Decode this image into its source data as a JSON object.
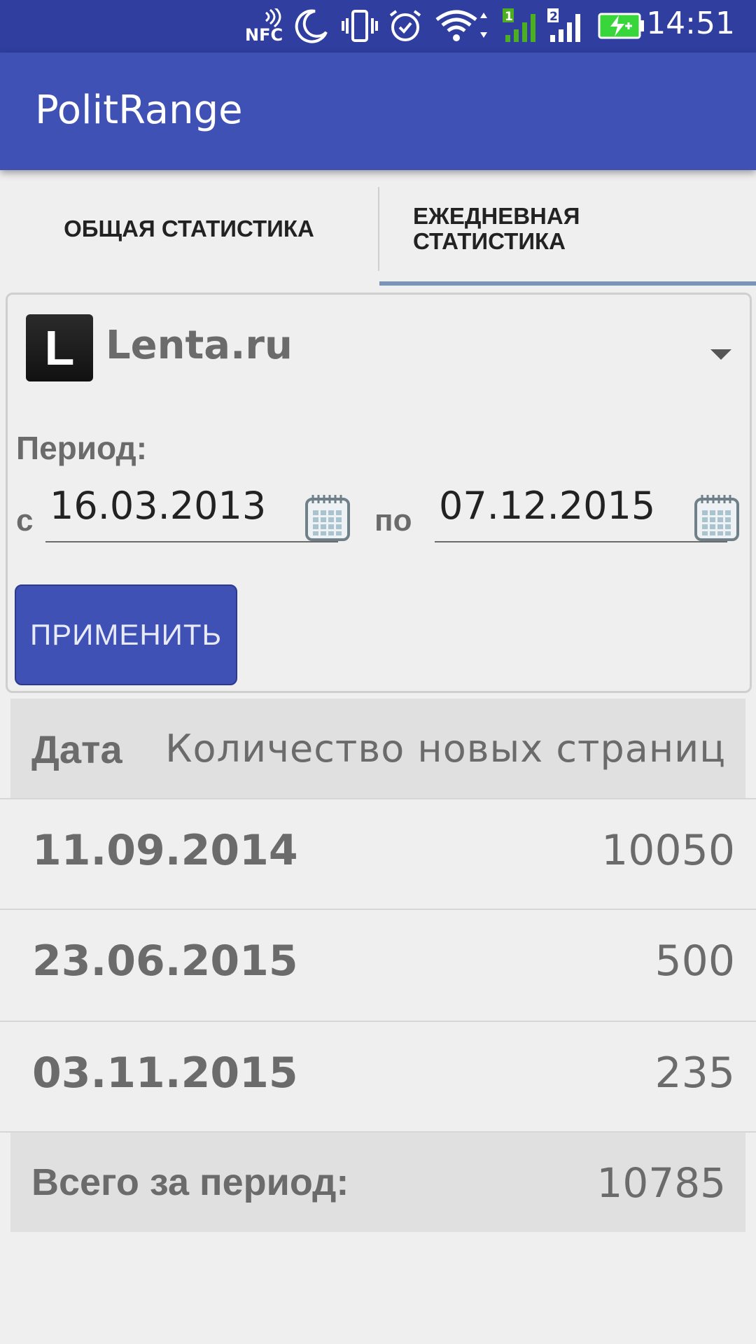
{
  "status_bar": {
    "time": "14:51",
    "icons": [
      "nfc-icon",
      "moon-icon",
      "vibrate-icon",
      "alarm-icon",
      "wifi-icon",
      "signal-sim1-icon",
      "signal-sim2-icon",
      "battery-charging-icon"
    ],
    "nfc_text": "NFC",
    "sim1_label": "1",
    "sim2_label": "2"
  },
  "app_bar": {
    "title": "PolitRange"
  },
  "tabs": [
    {
      "label": "ОБЩАЯ СТАТИСТИКА",
      "selected": false
    },
    {
      "label": "ЕЖЕДНЕВНАЯ СТАТИСТИКА",
      "selected": true
    }
  ],
  "filter": {
    "source_logo_letter": "L",
    "source_name": "Lenta.ru",
    "period_label": "Период:",
    "from_label": "с",
    "from_date": "16.03.2013",
    "to_label": "по",
    "to_date": "07.12.2015",
    "apply_label": "ПРИМЕНИТЬ"
  },
  "table": {
    "headers": {
      "date": "Дата",
      "count": "Количество новых страниц"
    },
    "rows": [
      {
        "date": "11.09.2014",
        "count": "10050"
      },
      {
        "date": "23.06.2015",
        "count": "500"
      },
      {
        "date": "03.11.2015",
        "count": "235"
      }
    ],
    "total_label": "Всего за период:",
    "total_value": "10785"
  },
  "colors": {
    "status_bar": "#2f3e9f",
    "app_bar": "#3f51b5",
    "tab_indicator": "#7a94b8",
    "signal_green": "#4caf1f",
    "battery_green": "#38d63a"
  }
}
